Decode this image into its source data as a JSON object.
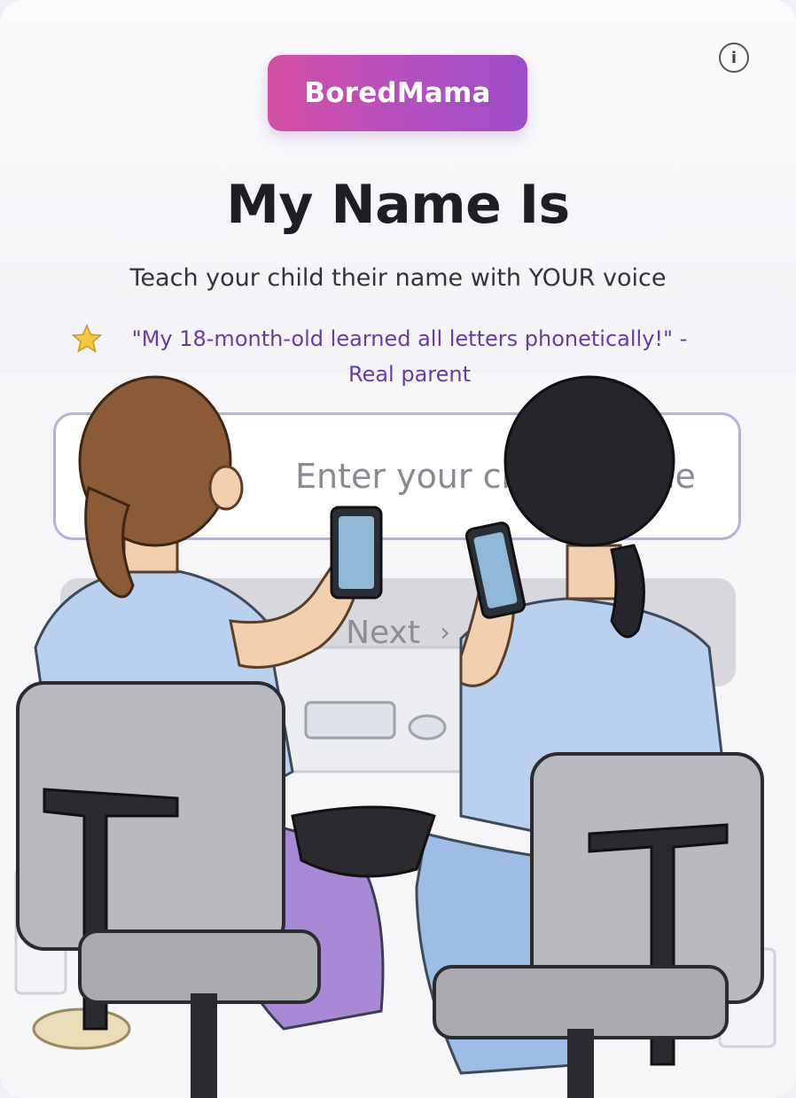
{
  "app": {
    "name": "BoredMama"
  },
  "header": {
    "info_icon": "info-icon",
    "info_glyph": "i"
  },
  "hero": {
    "title": "My Name Is",
    "subtitle": "Teach your child their name with YOUR voice",
    "testimonial": {
      "icon": "star-icon",
      "quote": "\"My 18-month-old learned all letters phonetically!\" -",
      "author": "Real parent"
    }
  },
  "form": {
    "name_placeholder": "Enter your child's name",
    "next_label": "Next",
    "next_icon": "chevron-right-icon",
    "next_glyph": "›"
  },
  "colors": {
    "brand_gradient_start": "#d44fa4",
    "brand_gradient_end": "#9c4ec8",
    "testimonial_text": "#6a3aa3",
    "input_border": "#b7b2dc",
    "next_button_bg": "#d7d7dd"
  }
}
